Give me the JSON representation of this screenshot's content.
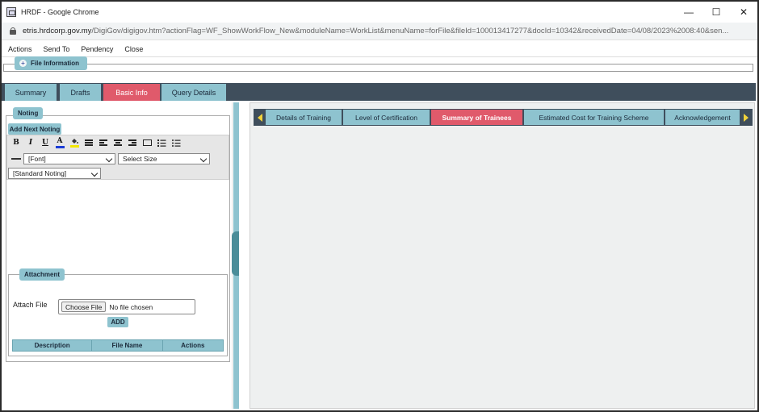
{
  "window": {
    "title": "HRDF - Google Chrome",
    "controls": {
      "minimize": "—",
      "maximize": "☐",
      "close": "✕"
    }
  },
  "address": {
    "host": "etris.hrdcorp.gov.my",
    "path": "/DigiGov/digigov.htm?actionFlag=WF_ShowWorkFlow_New&moduleName=WorkList&menuName=forFile&fileId=100013417277&docId=10342&receivedDate=04/08/2023%2008:40&sen..."
  },
  "menu": {
    "items": [
      "Actions",
      "Send To",
      "Pendency",
      "Close"
    ]
  },
  "file_info": {
    "label": "File Information",
    "icon": "plus-icon"
  },
  "main_tabs": {
    "items": [
      "Summary",
      "Drafts",
      "Basic Info",
      "Query Details"
    ],
    "active": "Basic Info"
  },
  "noting": {
    "label": "Noting",
    "add_next_label": "Add Next Noting",
    "toolbar": {
      "bold": "B",
      "italic": "I",
      "underline": "U",
      "font_color": "A",
      "font_select": "[Font]",
      "size_select": "Select Size",
      "noting_type_select": "[Standard Noting]"
    }
  },
  "attachment": {
    "label": "Attachment",
    "attach_file_label": "Attach File",
    "choose_button": "Choose File",
    "no_file_text": "No file chosen",
    "add_button": "ADD",
    "columns": [
      "Description",
      "File Name",
      "Actions"
    ]
  },
  "sub_tabs": {
    "items": [
      "Details of Training",
      "Level of Certification",
      "Summary of Trainees",
      "Estimated Cost for Training Scheme",
      "Acknowledgement"
    ],
    "active": "Summary of Trainees"
  },
  "colors": {
    "tab_bg": "#8ec3cf",
    "tab_active": "#e05a6b",
    "tabbar_bg": "#3f4e5c",
    "arrow": "#f2d33a"
  }
}
